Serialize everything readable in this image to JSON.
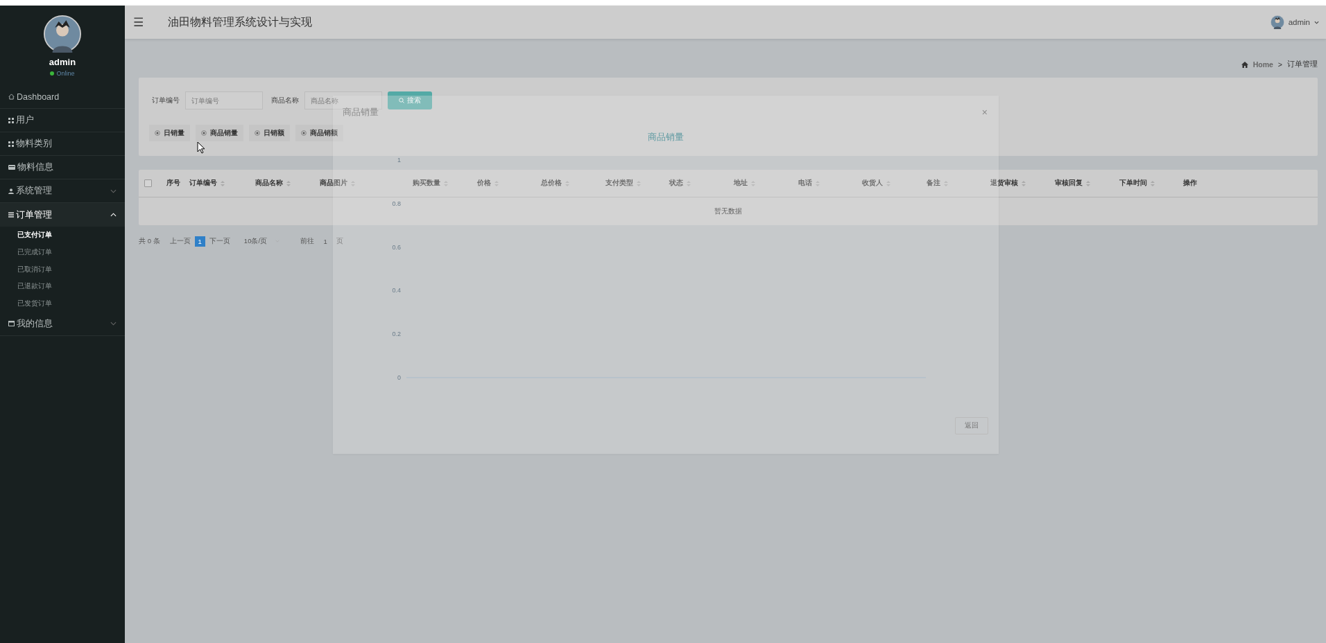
{
  "sidebar": {
    "user": {
      "name": "admin",
      "status": "Online"
    },
    "items": [
      {
        "kind": "home",
        "label": "Dashboard"
      },
      {
        "kind": "grid",
        "label": "用户"
      },
      {
        "kind": "grid",
        "label": "物料类别"
      },
      {
        "kind": "card",
        "label": "物料信息"
      },
      {
        "kind": "person",
        "label": "系统管理",
        "expanded": false
      },
      {
        "kind": "list",
        "label": "订单管理",
        "expanded": true,
        "children": [
          {
            "label": "已支付订单",
            "selected": true
          },
          {
            "label": "已完成订单",
            "selected": false
          },
          {
            "label": "已取消订单",
            "selected": false
          },
          {
            "label": "已退款订单",
            "selected": false
          },
          {
            "label": "已发货订单",
            "selected": false
          }
        ]
      },
      {
        "kind": "window",
        "label": "我的信息",
        "expanded": false
      }
    ]
  },
  "header": {
    "menu_icon": "☰",
    "title": "油田物料管理系统设计与实现",
    "user": "admin"
  },
  "breadcrumb": {
    "home": "Home",
    "separator": ">",
    "current": "订单管理"
  },
  "search": {
    "fields": [
      {
        "label": "订单编号",
        "placeholder": "订单编号"
      },
      {
        "label": "商品名称",
        "placeholder": "商品名称"
      }
    ],
    "button": "搜索",
    "options": [
      "日销量",
      "商品销量",
      "日销额",
      "商品销额"
    ]
  },
  "table": {
    "columns": [
      {
        "label": "序号",
        "sortable": false
      },
      {
        "label": "订单编号",
        "sortable": true
      },
      {
        "label": "商品名称",
        "sortable": true
      },
      {
        "label": "商品图片",
        "sortable": true
      },
      {
        "label": "购买数量",
        "sortable": true
      },
      {
        "label": "价格",
        "sortable": true
      },
      {
        "label": "总价格",
        "sortable": true
      },
      {
        "label": "支付类型",
        "sortable": true
      },
      {
        "label": "状态",
        "sortable": true
      },
      {
        "label": "地址",
        "sortable": true
      },
      {
        "label": "电话",
        "sortable": true
      },
      {
        "label": "收货人",
        "sortable": true
      },
      {
        "label": "备注",
        "sortable": true
      },
      {
        "label": "退货审核",
        "sortable": true
      },
      {
        "label": "审核回复",
        "sortable": true
      },
      {
        "label": "下单时间",
        "sortable": true
      },
      {
        "label": "操作",
        "sortable": false
      }
    ],
    "select_all_checked": false,
    "empty_text": "暂无数据"
  },
  "pagination": {
    "total": "共 0 条",
    "prev": "上一页",
    "pages": [
      {
        "label": "1",
        "selected": true
      }
    ],
    "next": "下一页",
    "page_size": "10条/页",
    "goto": "前往",
    "goto_value": "1",
    "goto_suffix": "页"
  },
  "dialog": {
    "title": "商品销量",
    "close": "×",
    "button": "返回",
    "chart_data": {
      "type": "bar",
      "title": "商品销量",
      "ylim": [
        0,
        1
      ],
      "yticks": [
        0,
        0.2,
        0.4,
        0.6,
        0.8,
        1
      ],
      "values": [
        0
      ]
    }
  }
}
